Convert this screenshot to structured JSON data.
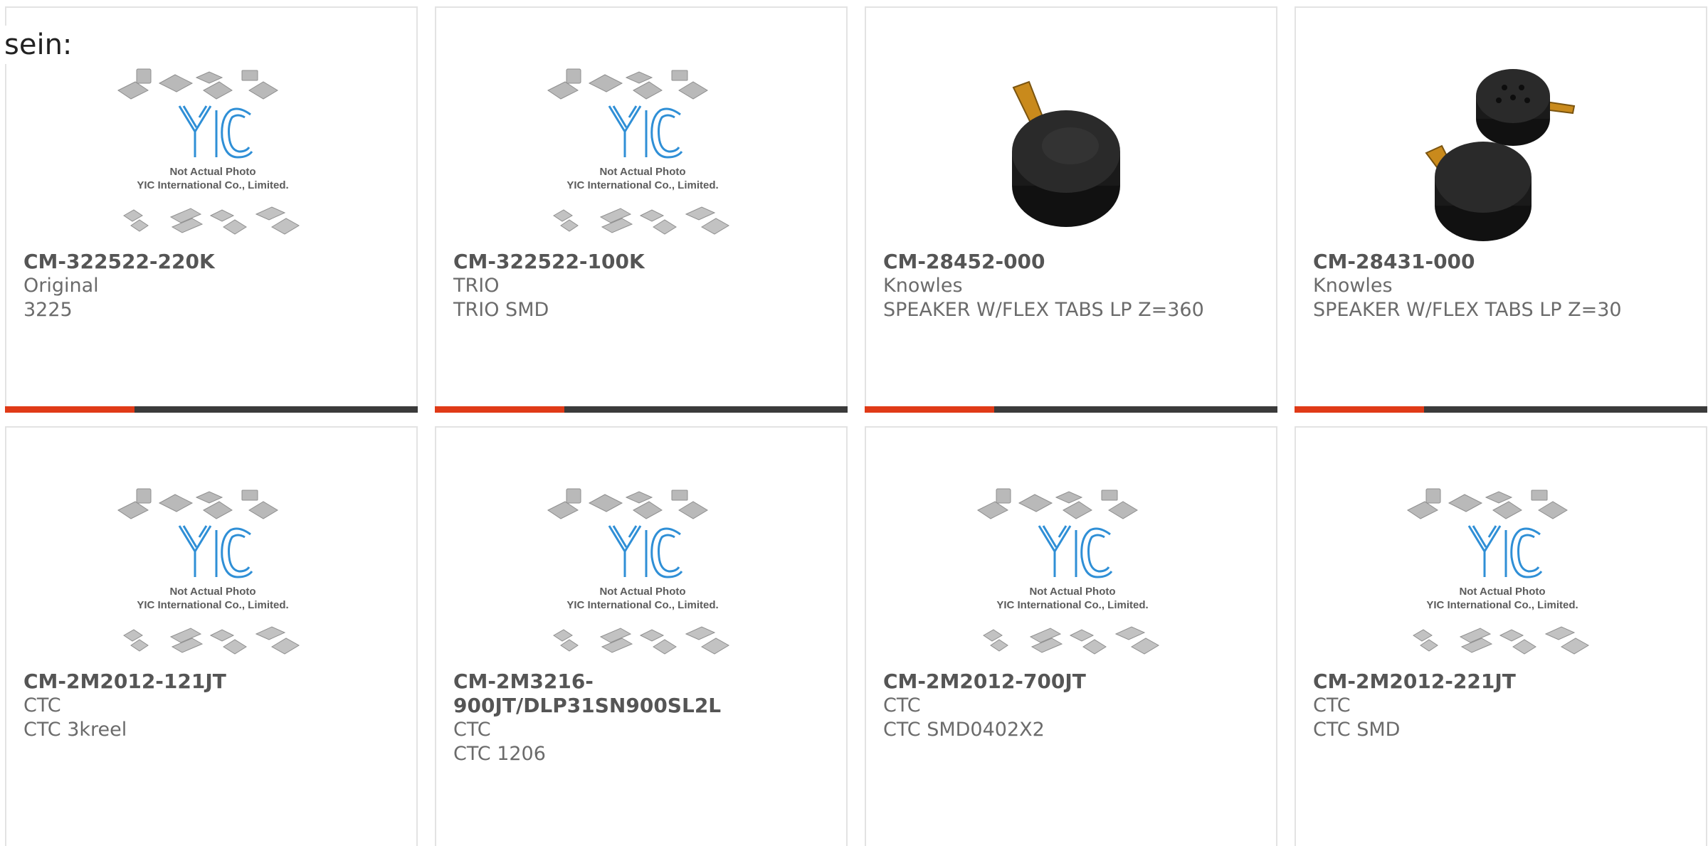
{
  "intro_text": "sein:",
  "accent_color": "#e03a17",
  "bar_color": "#3b3b3b",
  "products": [
    {
      "part_number": "CM-322522-220K",
      "manufacturer": "Original",
      "description": "3225",
      "image": "yic-placeholder-image",
      "placeholder_line1": "Not Actual Photo",
      "placeholder_line2": "YIC International Co., Limited."
    },
    {
      "part_number": "CM-322522-100K",
      "manufacturer": "TRIO",
      "description": "TRIO SMD",
      "image": "yic-placeholder-image",
      "placeholder_line1": "Not Actual Photo",
      "placeholder_line2": "YIC International Co., Limited."
    },
    {
      "part_number": "CM-28452-000",
      "manufacturer": "Knowles",
      "description": "SPEAKER W/FLEX TABS LP Z=360",
      "image": "speaker-photo"
    },
    {
      "part_number": "CM-28431-000",
      "manufacturer": "Knowles",
      "description": "SPEAKER W/FLEX TABS LP Z=30",
      "image": "speaker-pair-photo"
    },
    {
      "part_number": "CM-2M2012-121JT",
      "manufacturer": "CTC",
      "description": "CTC 3kreel",
      "image": "yic-placeholder-image",
      "placeholder_line1": "Not Actual Photo",
      "placeholder_line2": "YIC International Co., Limited."
    },
    {
      "part_number": "CM-2M3216-900JT/DLP31SN900SL2L",
      "manufacturer": "CTC",
      "description": "CTC 1206",
      "image": "yic-placeholder-image",
      "placeholder_line1": "Not Actual Photo",
      "placeholder_line2": "YIC International Co., Limited."
    },
    {
      "part_number": "CM-2M2012-700JT",
      "manufacturer": "CTC",
      "description": "CTC SMD0402X2",
      "image": "yic-placeholder-image",
      "placeholder_line1": "Not Actual Photo",
      "placeholder_line2": "YIC International Co., Limited."
    },
    {
      "part_number": "CM-2M2012-221JT",
      "manufacturer": "CTC",
      "description": "CTC SMD",
      "image": "yic-placeholder-image",
      "placeholder_line1": "Not Actual Photo",
      "placeholder_line2": "YIC International Co., Limited."
    }
  ]
}
